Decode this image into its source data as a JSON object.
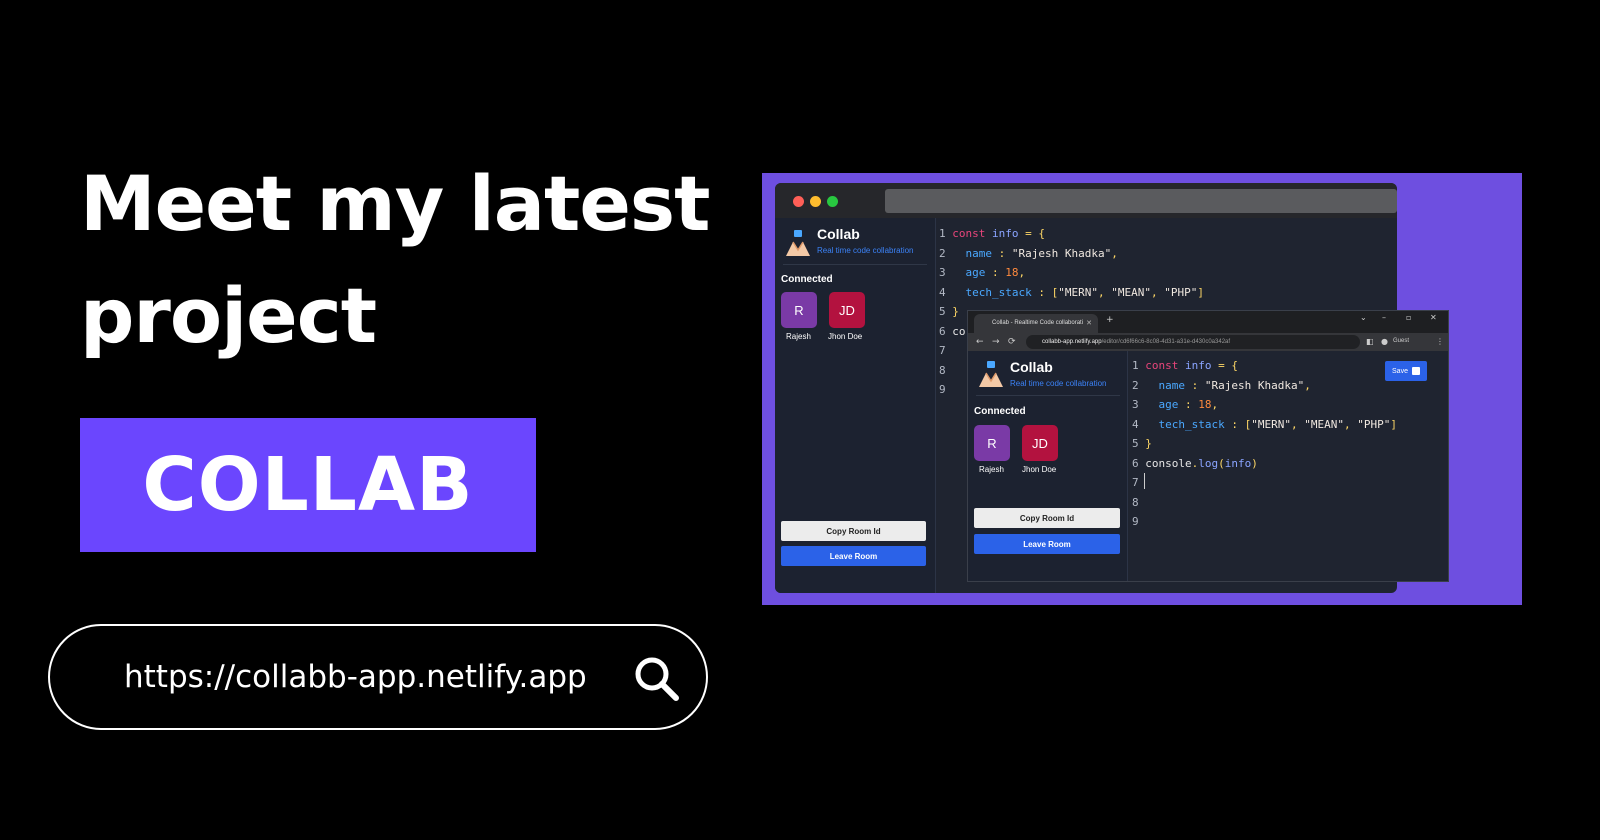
{
  "headline": {
    "line1": "Meet my latest",
    "line2": "project"
  },
  "brand_label": "COLLAB",
  "link": {
    "url": "https://collabb-app.netlify.app"
  },
  "colors": {
    "accent": "#6b46fe",
    "frame": "#6e4fe0",
    "primary_button": "#2b62e8",
    "keyword": "#e8457a",
    "number": "#ff8a3d",
    "property": "#4aa8ff"
  },
  "app": {
    "title": "Collab",
    "tagline": "Real time code collabration",
    "connected_label": "Connected",
    "users": [
      {
        "initials": "R",
        "name": "Rajesh",
        "color": "#7a3aa6"
      },
      {
        "initials": "JD",
        "name": "Jhon Doe",
        "color": "#b3123f"
      }
    ],
    "copy_button": "Copy Room Id",
    "leave_button": "Leave Room",
    "save_button": "Save",
    "code_lines": [
      {
        "n": "1",
        "parts": [
          {
            "c": "kw",
            "t": "const "
          },
          {
            "c": "vr",
            "t": "info "
          },
          {
            "c": "pu",
            "t": "= {"
          }
        ]
      },
      {
        "n": "2",
        "parts": [
          {
            "c": "pr",
            "t": "  name "
          },
          {
            "c": "pu",
            "t": ": "
          },
          {
            "c": "st",
            "t": "\"Rajesh Khadka\""
          },
          {
            "c": "pu",
            "t": ","
          }
        ]
      },
      {
        "n": "3",
        "parts": [
          {
            "c": "pr",
            "t": "  age "
          },
          {
            "c": "pu",
            "t": ": "
          },
          {
            "c": "nm",
            "t": "18"
          },
          {
            "c": "pu",
            "t": ","
          }
        ]
      },
      {
        "n": "4",
        "parts": [
          {
            "c": "pr",
            "t": "  tech_stack "
          },
          {
            "c": "pu",
            "t": ": ["
          },
          {
            "c": "st",
            "t": "\"MERN\""
          },
          {
            "c": "pu",
            "t": ", "
          },
          {
            "c": "st",
            "t": "\"MEAN\""
          },
          {
            "c": "pu",
            "t": ", "
          },
          {
            "c": "st",
            "t": "\"PHP\""
          },
          {
            "c": "pu",
            "t": "]"
          }
        ]
      },
      {
        "n": "5",
        "parts": [
          {
            "c": "pu",
            "t": "}"
          }
        ]
      },
      {
        "n": "6",
        "parts": [
          {
            "c": "tx",
            "t": "console"
          },
          {
            "c": "pu",
            "t": "."
          },
          {
            "c": "vr",
            "t": "log"
          },
          {
            "c": "pu",
            "t": "("
          },
          {
            "c": "vr",
            "t": "info"
          },
          {
            "c": "pu",
            "t": ")"
          }
        ]
      },
      {
        "n": "7",
        "parts": []
      },
      {
        "n": "8",
        "parts": []
      },
      {
        "n": "9",
        "parts": []
      }
    ],
    "outer_line6_partial": "co"
  },
  "browser": {
    "tab_title": "Collab - Realtime Code collaborati",
    "url_host": "collabb-app.netlify.app",
    "url_path": "/editor/cd6f66c6-8c08-4d31-a31e-d430c0a342af",
    "guest_label": "Guest"
  }
}
